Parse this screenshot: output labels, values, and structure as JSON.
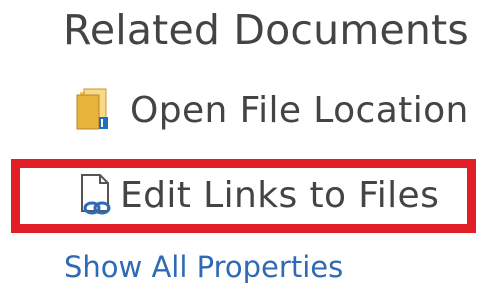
{
  "section": {
    "title": "Related Documents"
  },
  "actions": {
    "open_file_location": "Open File Location",
    "edit_links_to_files": "Edit Links to Files"
  },
  "links": {
    "show_all_properties": "Show All Properties"
  },
  "icons": {
    "open_file_location": "folder-icon",
    "edit_links_to_files": "document-link-icon"
  },
  "colors": {
    "text": "#444444",
    "link": "#2f6bb5",
    "highlight": "#e21e26",
    "folder": "#e8b33a"
  }
}
